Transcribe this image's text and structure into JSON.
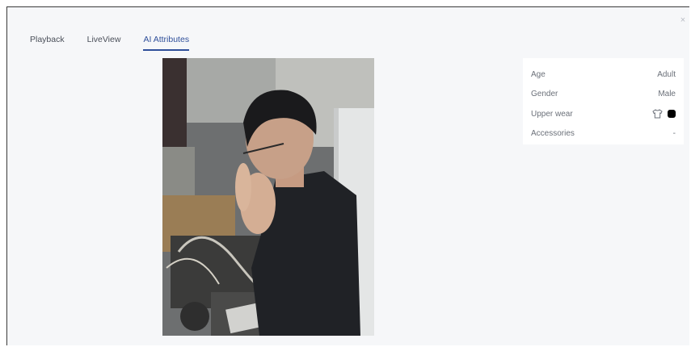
{
  "dialog": {
    "close_label": "×"
  },
  "tabs": [
    {
      "label": "Playback"
    },
    {
      "label": "LiveView"
    },
    {
      "label": "AI Attributes"
    }
  ],
  "active_tab": "AI Attributes",
  "attributes": {
    "age": {
      "label": "Age",
      "value": "Adult"
    },
    "gender": {
      "label": "Gender",
      "value": "Male"
    },
    "upper_wear": {
      "label": "Upper wear",
      "icon": "tshirt-icon",
      "color": "#000000"
    },
    "accessories": {
      "label": "Accessories",
      "value": "-"
    }
  },
  "colors": {
    "accent": "#2f4f9a",
    "background": "#f6f7f9"
  }
}
